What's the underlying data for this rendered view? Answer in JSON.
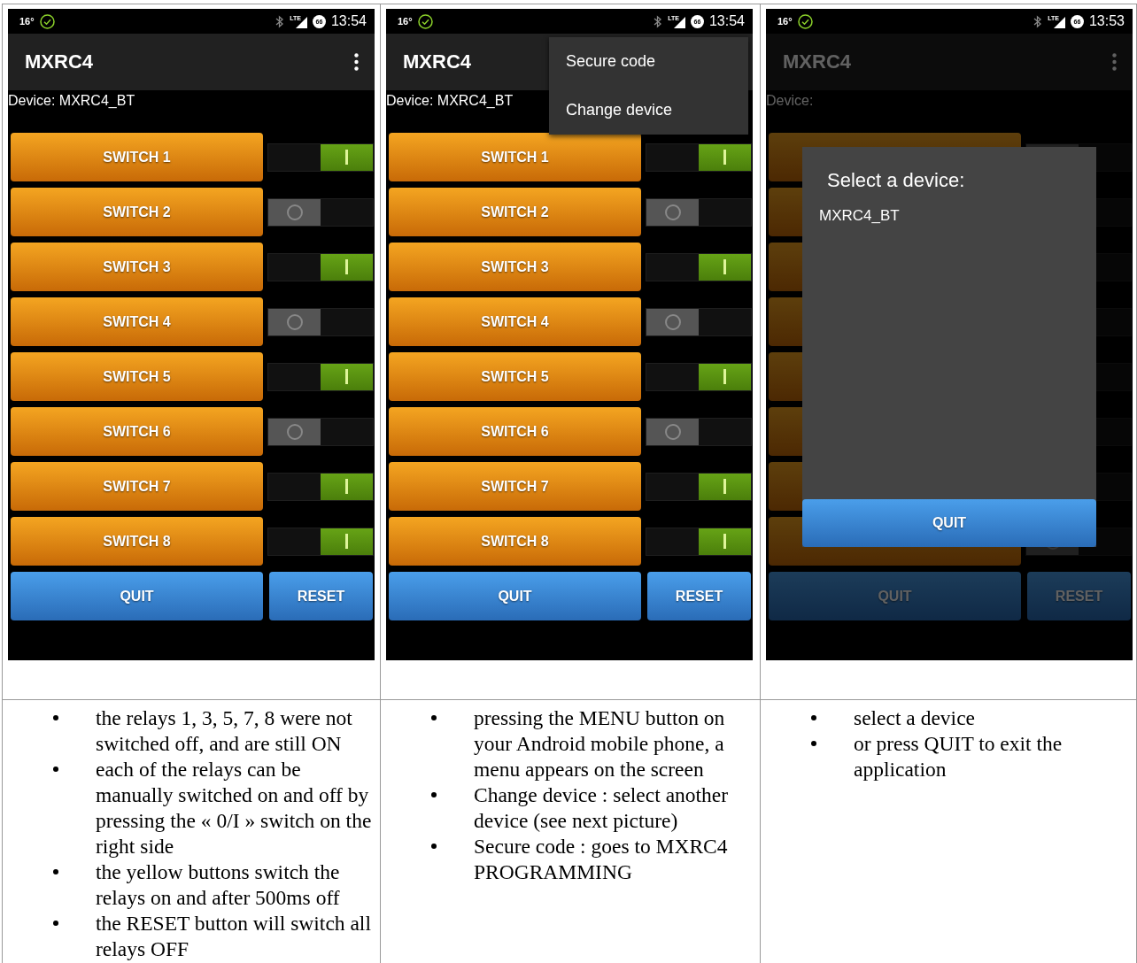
{
  "screens": [
    {
      "status_bar": {
        "temperature": "16°",
        "network": "LTE",
        "battery": "66",
        "time": "13:54"
      },
      "app_bar": {
        "title": "MXRC4"
      },
      "device_label": "Device: MXRC4_BT",
      "switches": [
        {
          "label": "SWITCH 1",
          "on": true
        },
        {
          "label": "SWITCH 2",
          "on": false
        },
        {
          "label": "SWITCH 3",
          "on": true
        },
        {
          "label": "SWITCH 4",
          "on": false
        },
        {
          "label": "SWITCH 5",
          "on": true
        },
        {
          "label": "SWITCH 6",
          "on": false
        },
        {
          "label": "SWITCH 7",
          "on": true
        },
        {
          "label": "SWITCH 8",
          "on": true
        }
      ],
      "buttons": [
        "QUIT",
        "RESET"
      ]
    },
    {
      "status_bar": {
        "temperature": "16°",
        "network": "LTE",
        "battery": "66",
        "time": "13:54"
      },
      "app_bar": {
        "title": "MXRC4"
      },
      "device_label": "Device: MXRC4_BT",
      "switches": [
        {
          "label": "SWITCH 1",
          "on": true
        },
        {
          "label": "SWITCH 2",
          "on": false
        },
        {
          "label": "SWITCH 3",
          "on": true
        },
        {
          "label": "SWITCH 4",
          "on": false
        },
        {
          "label": "SWITCH 5",
          "on": true
        },
        {
          "label": "SWITCH 6",
          "on": false
        },
        {
          "label": "SWITCH 7",
          "on": true
        },
        {
          "label": "SWITCH 8",
          "on": true
        }
      ],
      "buttons": [
        "QUIT",
        "RESET"
      ],
      "menu": {
        "items": [
          "Secure code",
          "Change device"
        ]
      }
    },
    {
      "status_bar": {
        "temperature": "16°",
        "network": "LTE",
        "battery": "66",
        "time": "13:53"
      },
      "app_bar": {
        "title": "MXRC4"
      },
      "device_label": "Device:",
      "switches": [
        {
          "on": false
        },
        {
          "on": false
        },
        {
          "on": false
        },
        {
          "on": false
        },
        {
          "on": false
        },
        {
          "on": false
        },
        {
          "on": false
        },
        {
          "on": false
        }
      ],
      "buttons": [
        "QUIT",
        "RESET"
      ],
      "dialog": {
        "title": "Select a device:",
        "items": [
          "MXRC4_BT"
        ],
        "button": "QUIT"
      }
    }
  ],
  "notes": [
    {
      "items": [
        "the relays 1, 3, 5, 7, 8 were not switched off, and are still ON",
        "each of the relays can be manually switched on and off by pressing the « 0/I » switch on the right side",
        "the yellow buttons switch the relays on and after 500ms off",
        "the RESET button will switch all relays OFF"
      ]
    },
    {
      "items": [
        "pressing the MENU button on your Android mobile phone, a menu appears on the screen",
        "Change device : select another device (see next picture)",
        "Secure code : goes to MXRC4 PROGRAMMING"
      ]
    },
    {
      "items": [
        "select a device",
        "or press QUIT to exit the application"
      ]
    }
  ]
}
